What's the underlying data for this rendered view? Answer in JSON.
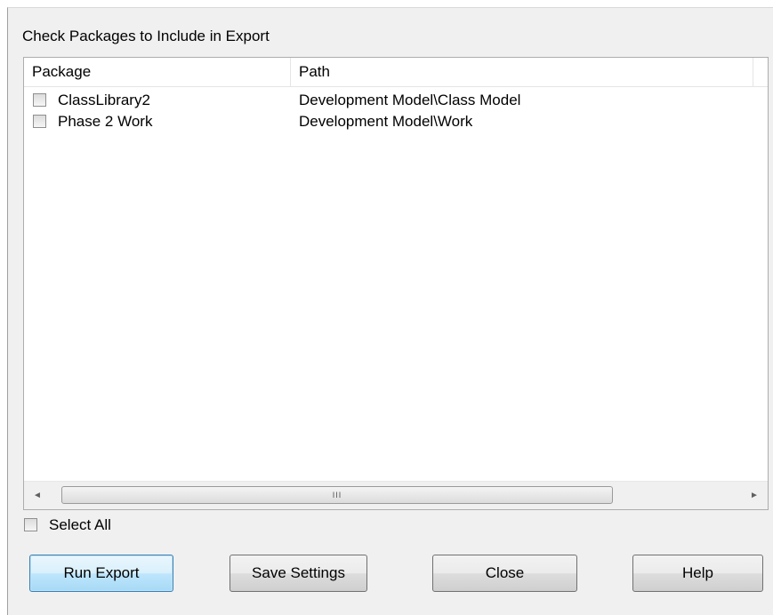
{
  "group_label": "Check Packages to Include in Export",
  "table": {
    "columns": [
      "Package",
      "Path"
    ],
    "rows": [
      {
        "package": "ClassLibrary2",
        "path": "Development Model\\Class Model",
        "checked": false
      },
      {
        "package": "Phase 2 Work",
        "path": "Development Model\\Work",
        "checked": false
      }
    ]
  },
  "scrollbar": {
    "grip": "III",
    "left_arrow": "◄",
    "right_arrow": "►"
  },
  "select_all": {
    "label": "Select All",
    "checked": false
  },
  "buttons": {
    "run_export": "Run Export",
    "save_settings": "Save Settings",
    "close": "Close",
    "help": "Help"
  }
}
